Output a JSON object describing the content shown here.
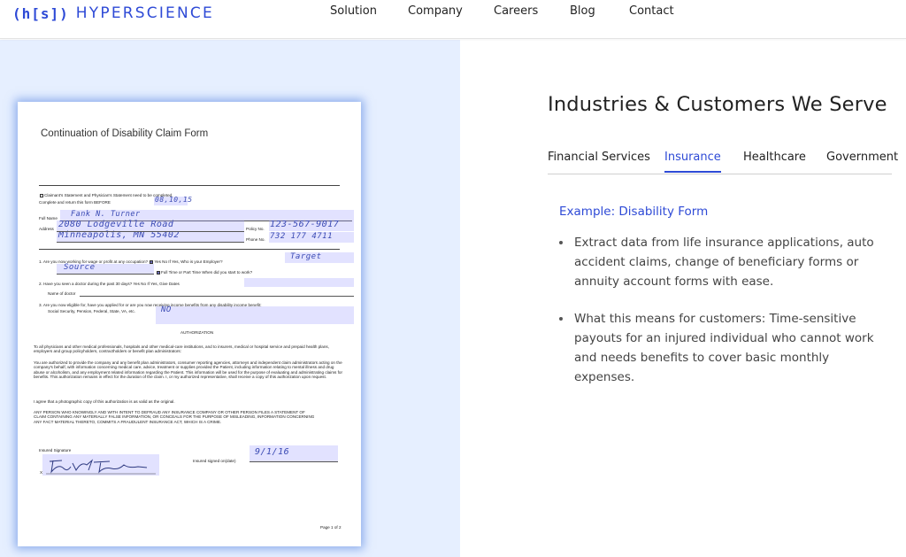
{
  "header": {
    "logo_mark": "(h[s])",
    "logo_word": "HYPERSCIENCE",
    "nav": [
      "Solution",
      "Company",
      "Careers",
      "Blog",
      "Contact"
    ]
  },
  "form": {
    "title": "Continuation of Disability Claim Form",
    "checkbox_line": "Claimant's Statement and Physician's Statement need to be completed.",
    "return_label": "Complete and return this form BEFORE",
    "return_value": "08,10,15",
    "fullname_label": "Full Name",
    "fullname_value": "Fank N. Turner",
    "address_label": "Address",
    "address_value_1": "2080 Lodgeville Road",
    "address_value_2": "Minneapolis, MN 55402",
    "policy_label": "Policy No.",
    "policy_value": "123-567-9017",
    "phone_label": "Phone No.",
    "phone_value": "732 177 4711",
    "q1_label": "1.  Are you now working for wage or profit at any occupation?",
    "q1_options": "Yes   No   If Yes, Who is your Employer?",
    "q1_employer": "Target",
    "q1_source": "Source",
    "q1_time": "Full Time  or   Part Time    When did you start to work?",
    "q2_label": "2.  Have you seen a doctor during the past 30 days?   Yes   No  If Yes, Give Dates",
    "q2_doctor": "Name of doctor",
    "q3_label": "3.  Are you now eligible for, have you applied for or are you now receiving income benefits from any disability income benefit:",
    "q3_sub": "Social Security, Pension, Federal, State, VA, etc.",
    "q3_value": "NO",
    "auth_heading": "AUTHORIZATION",
    "auth_p1": "To all physicians and other medical professionals, hospitals and other medical-care institutions, and to insurers, medical or hospital service and prepaid health plans, employers and group policyholders, contractholders or benefit plan administrators:",
    "auth_p2": "You are authorized to provide the company and any benefit plan administrators, consumer reporting agencies, attorneys and independent claim administrators acting on the company's behalf, with information concerning medical care, advice, treatment or supplies provided the Patient, including information relating to mental illness and drug abuse or alcoholism, and any employment related information regarding the Patient. This information will be used for the purpose of evaluating and administrating claims for benefits. This authorization remains in effect for the duration of the claim.  I, or my authorized representative, shall receive a copy of this authorization upon request.",
    "auth_p3": "I agree that a photographic copy of this authorization is as valid as the original.",
    "auth_p4": "ANY PERSON WHO KNOWINGLY AND WITH INTENT TO DEFRAUD ANY INSURANCE COMPANY OR OTHER PERSON FILES A STATEMENT OF CLAIM CONTAINING ANY MATERIALLY FALSE INFORMATION, OR CONCEALS FOR THE PURPOSE OF MISLEADING, INFORMATION CONCERNING ANY FACT MATERIAL THERETO, COMMITS A FRAUDULENT INSURANCE ACT, WHICH IS A CRIME.",
    "sig_label": "Insured Signature",
    "sig_x": "X",
    "signed_label": "Insured signed on(date)",
    "signed_value": "9/1/16",
    "page": "Page 1 of 2"
  },
  "right": {
    "title": "Industries & Customers We Serve",
    "tabs": [
      "Financial Services",
      "Insurance",
      "Healthcare",
      "Government"
    ],
    "active_tab": "Insurance",
    "example": "Example: Disability Form",
    "bullets": [
      "Extract data from life insurance applications, auto accident claims, change of beneficiary forms or annuity account forms with ease.",
      "What this means for customers: Time-sensitive payouts for an injured individual who cannot work and needs benefits to cover basic monthly expenses."
    ]
  },
  "colors": {
    "brand": "#2e4ad6",
    "panel_bg": "#e6efff",
    "doc_glow": "#4678dc",
    "highlight": "#9696ff"
  }
}
